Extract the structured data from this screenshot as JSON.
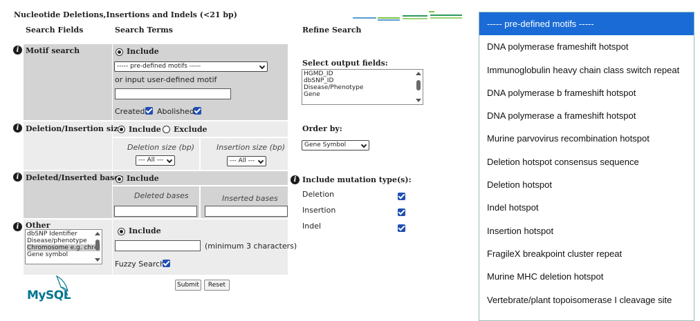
{
  "page": {
    "title": "Nucleotide Deletions,Insertions and Indels (<21 bp)"
  },
  "columns": {
    "search_fields": "Search Fields",
    "search_terms": "Search Terms",
    "refine_search": "Refine Search"
  },
  "motif": {
    "label": "Motif search",
    "include_label": "Include",
    "select_value": "----- pre-defined motifs -----",
    "or_text": "or input user-defined motif",
    "user_motif_value": "",
    "created_label": "Created",
    "abolished_label": "Abolished"
  },
  "size": {
    "label": "Deletion/Insertion size",
    "include_label": "Include",
    "exclude_label": "Exclude",
    "deletion_header": "Deletion size (bp)",
    "insertion_header": "Insertion size (bp)",
    "deletion_select": "--- All ---",
    "insertion_select": "--- All ---"
  },
  "bases": {
    "label": "Deleted/Inserted bases",
    "include_label": "Include",
    "deleted_header": "Deleted bases",
    "inserted_header": "Inserted bases",
    "deleted_value": "",
    "inserted_value": ""
  },
  "other": {
    "label": "Other",
    "list": [
      "dbSNP Identifier",
      "Disease/phenotype",
      "Chromosome e.g. chr4",
      "Gene symbol"
    ],
    "include_label": "Include",
    "text_value": "",
    "hint": "(minimum 3 characters)",
    "fuzzy_label": "Fuzzy Search"
  },
  "refine": {
    "output_label": "Select output fields:",
    "output_fields": [
      "HGMD_ID",
      "dbSNP_ID",
      "Disease/Phenotype",
      "Gene"
    ],
    "order_label": "Order by:",
    "order_value": "Gene Symbol",
    "mutation_label": "Include mutation type(s):",
    "mutation_types": [
      "Deletion",
      "Insertion",
      "Indel"
    ]
  },
  "buttons": {
    "submit": "Submit",
    "reset": "Reset"
  },
  "logo": {
    "text": "MySQL"
  },
  "dropdown": {
    "options": [
      "----- pre-defined motifs -----",
      "DNA polymerase frameshift hotspot",
      "Immunoglobulin heavy chain class switch repeat",
      "DNA polymerase b frameshift hotspot",
      "DNA polymerase a frameshift hotspot",
      "Murine parvovirus recombination hotspot",
      "Deletion hotspot consensus sequence",
      "Deletion hotspot",
      "Indel hotspot",
      "Insertion hotspot",
      "FragileX breakpoint cluster repeat",
      "Murine MHC deletion hotspot",
      "Vertebrate/plant topoisomerase I cleavage site"
    ]
  },
  "colors": {
    "accent": "#1a6bd6",
    "checkbox": "#1f4eb4",
    "panel_gray": "#d3d3d3",
    "panel_light": "#ececec",
    "logo_blue": "#00758f",
    "logo_orange": "#f29111"
  }
}
